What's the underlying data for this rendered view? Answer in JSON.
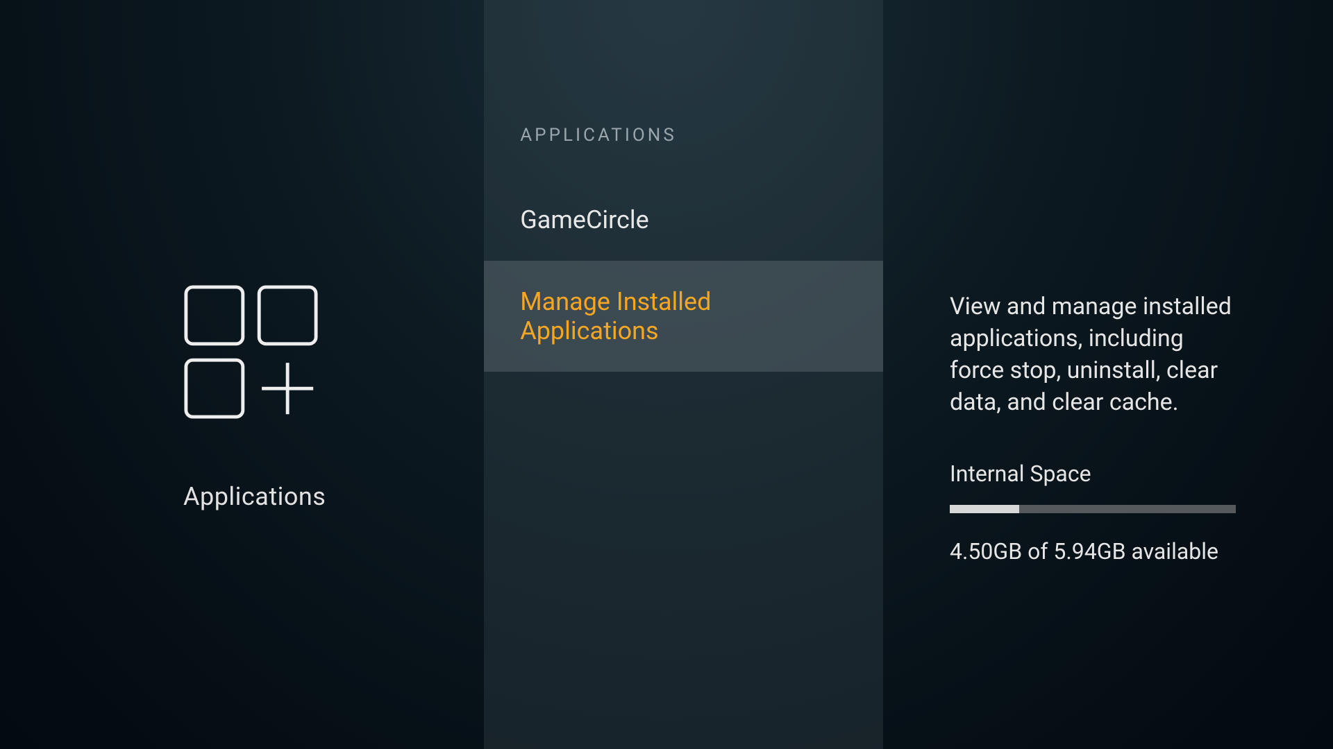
{
  "left": {
    "title": "Applications"
  },
  "middle": {
    "header": "APPLICATIONS",
    "items": [
      {
        "label": "GameCircle"
      },
      {
        "label": "Manage Installed Applications"
      }
    ]
  },
  "right": {
    "description": "View and manage installed applications, including force stop, uninstall, clear data, and clear cache.",
    "storage_label": "Internal Space",
    "storage_text": "4.50GB of 5.94GB available",
    "storage_used_pct": 24.2
  }
}
